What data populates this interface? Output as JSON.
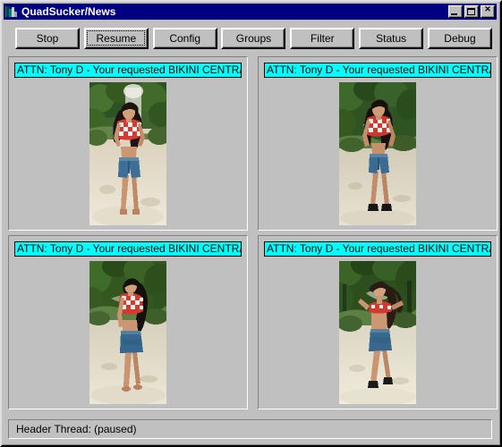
{
  "window": {
    "title": "QuadSucker/News",
    "icon": "app-building-icon",
    "titlebar_color": "#000080",
    "titlebar_text_color": "#ffffff",
    "face_color": "#c0c0c0",
    "controls": {
      "minimize_label": "_",
      "maximize_label": "□",
      "close_label": "✕"
    }
  },
  "toolbar": {
    "buttons": [
      {
        "label": "Stop",
        "name": "stop-button",
        "focused": false
      },
      {
        "label": "Resume",
        "name": "resume-button",
        "focused": true
      },
      {
        "label": "Config",
        "name": "config-button",
        "focused": false
      },
      {
        "label": "Groups",
        "name": "groups-button",
        "focused": false
      },
      {
        "label": "Filter",
        "name": "filter-button",
        "focused": false
      },
      {
        "label": "Status",
        "name": "status-button",
        "focused": false
      },
      {
        "label": "Debug",
        "name": "debug-button",
        "focused": false
      }
    ]
  },
  "panels": [
    {
      "header": "ATTN: Tony D - Your requested BIKINI CENTRAL",
      "header_bg": "#00ffff",
      "header_fg": "#000000",
      "image_alt": "Woman in red-and-white checkered crop top and denim shorts standing on a sandy path with green trees behind"
    },
    {
      "header": "ATTN: Tony D - Your requested BIKINI CENTRAL",
      "header_bg": "#00ffff",
      "header_fg": "#000000",
      "image_alt": "Woman in red-and-white checkered crop top and denim shorts standing on a pale gravel road lined with trees"
    },
    {
      "header": "ATTN: Tony D - Your requested BIKINI CENTRAL",
      "header_bg": "#00ffff",
      "header_fg": "#000000",
      "image_alt": "Woman in red-and-white checkered crop top and denim skirt turned sideways on a sandy forest path"
    },
    {
      "header": "ATTN: Tony D - Your requested BIKINI CENTRAL",
      "header_bg": "#00ffff",
      "header_fg": "#000000",
      "image_alt": "Woman in denim skirt with long hair raised arms on a bright sandy road under dense green trees"
    }
  ],
  "statusbar": {
    "text": "Header Thread:  (paused)"
  }
}
